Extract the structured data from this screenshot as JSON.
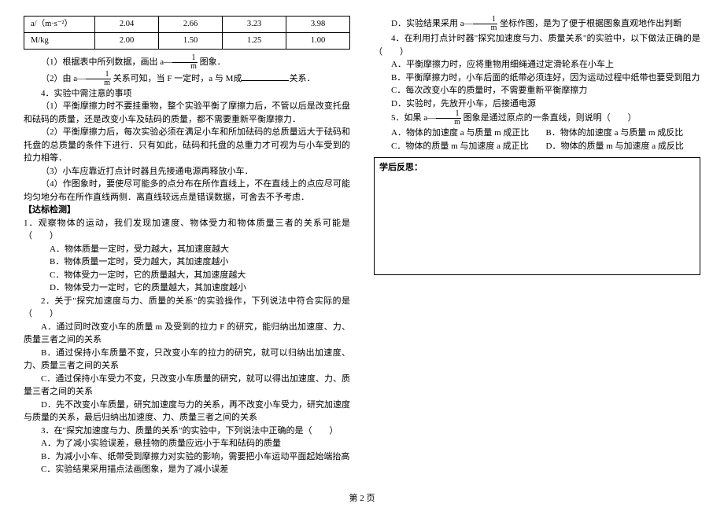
{
  "table": {
    "row1_head": "a/（m·s⁻²）",
    "row1": [
      "2.04",
      "2.66",
      "3.23",
      "3.98"
    ],
    "row2_head": "M/kg",
    "row2": [
      "2.00",
      "1.50",
      "1.25",
      "1.00"
    ]
  },
  "left": {
    "p1_prefix": "（1）根据表中所列数据，画出 a—",
    "p1_suffix": " 图象．",
    "p2_prefix": "（2）由 a—",
    "p2_mid": " 关系可知，当 F 一定时，a 与 M成",
    "p2_suffix": "关系．",
    "p3": "4．实验中需注意的事项",
    "p4": "（1）平衡摩擦力时不要挂重物，整个实验平衡了摩擦力后，不管以后是改变托盘和砝码的质量，还是改变小车及砝码的质量，都不需要重新平衡摩擦力．",
    "p5": "（2）平衡摩擦力后，每次实验必须在满足小车和所加砝码的总质量远大于砝码和托盘的总质量的条件下进行．只有如此，砝码和托盘的总重力才可视为与小车受到的拉力相等．",
    "p6": "（3）小车应靠近打点计时器且先接通电源再释放小车．",
    "p7": "（4）作图象时，要使尽可能多的点分布在所作直线上，不在直线上的点应尽可能均匀地分布在所作直线两侧．离直线较远点是错误数据，可舍去不予考虑．",
    "section": "【达标检测】",
    "q1": "1．观察物体的运动，我们发现加速度、物体受力和物体质量三者的关系可能是（　　）",
    "q1a": "A．物体质量一定时，受力越大，其加速度越大",
    "q1b": "B．物体质量一定时，受力越大，其加速度越小",
    "q1c": "C．物体受力一定时，它的质量越大，其加速度越大",
    "q1d": "D．物体受力一定时，它的质量越大，其加速度越小",
    "q2": "2．关于\"探究加速度与力、质量的关系\"的实验操作，下列说法中符合实际的是（　　）",
    "q2a": "A．通过同时改变小车的质量 m 及受到的拉力 F 的研究，能归纳出加速度、力、质量三者之间的关系",
    "q2b": "B．通过保持小车质量不变，只改变小车的拉力的研究，就可以归纳出加速度、力、质量三者之间的关系",
    "q2c": "C．通过保持小车受力不变，只改变小车质量的研究，就可以得出加速度、力、质量三者之间的关系",
    "q2d": "D．先不改变小车质量，研究加速度与力的关系，再不改变小车受力，研究加速度与质量的关系，最后归纳出加速度、力、质量三者之间的关系",
    "q3": "3．在\"探究加速度与力、质量的关系\"的实验中，下列说法中正确的是（　　）",
    "q3a": "A．为了减小实验误差，悬挂物的质量应远小于车和砝码的质量",
    "q3b": "B．为减小小车、纸带受到摩擦力对实验的影响，需要把小车运动平面起始端抬高",
    "q3c": "C．实验结果采用描点法画图象，是为了减小误差"
  },
  "right": {
    "q3d_prefix": "D．实验结果采用 a—",
    "q3d_suffix": " 坐标作图，是为了便于根据图象直观地作出判断",
    "q4": "4．在利用打点计时器\"探究加速度与力、质量关系\"的实验中，以下做法正确的是（　　）",
    "q4a": "A．平衡摩擦力时，应将重物用细绳通过定滑轮系在小车上",
    "q4b": "B．平衡摩擦力时，小车后面的纸带必须连好，因为运动过程中纸带也要受到阻力",
    "q4c": "C．每次改变小车的质量时，不需要重新平衡摩擦力",
    "q4d": "D．实验时，先放开小车，后接通电源",
    "q5_prefix": "5．如果 a—",
    "q5_suffix": " 图象是通过原点的一条直线，则说明（　　）",
    "q5a": "A．物体的加速度 a 与质量 m 成正比",
    "q5b": "B．物体的加速度 a 与质量 m 成反比",
    "q5c": "C．物体的质量 m 与加速度 a 成正比",
    "q5d": "D．物体的质量 m 与加速度 a 成反比",
    "box_title": "学后反思："
  },
  "frac": {
    "top": "1",
    "bot": "m"
  },
  "footer": "第 2 页"
}
